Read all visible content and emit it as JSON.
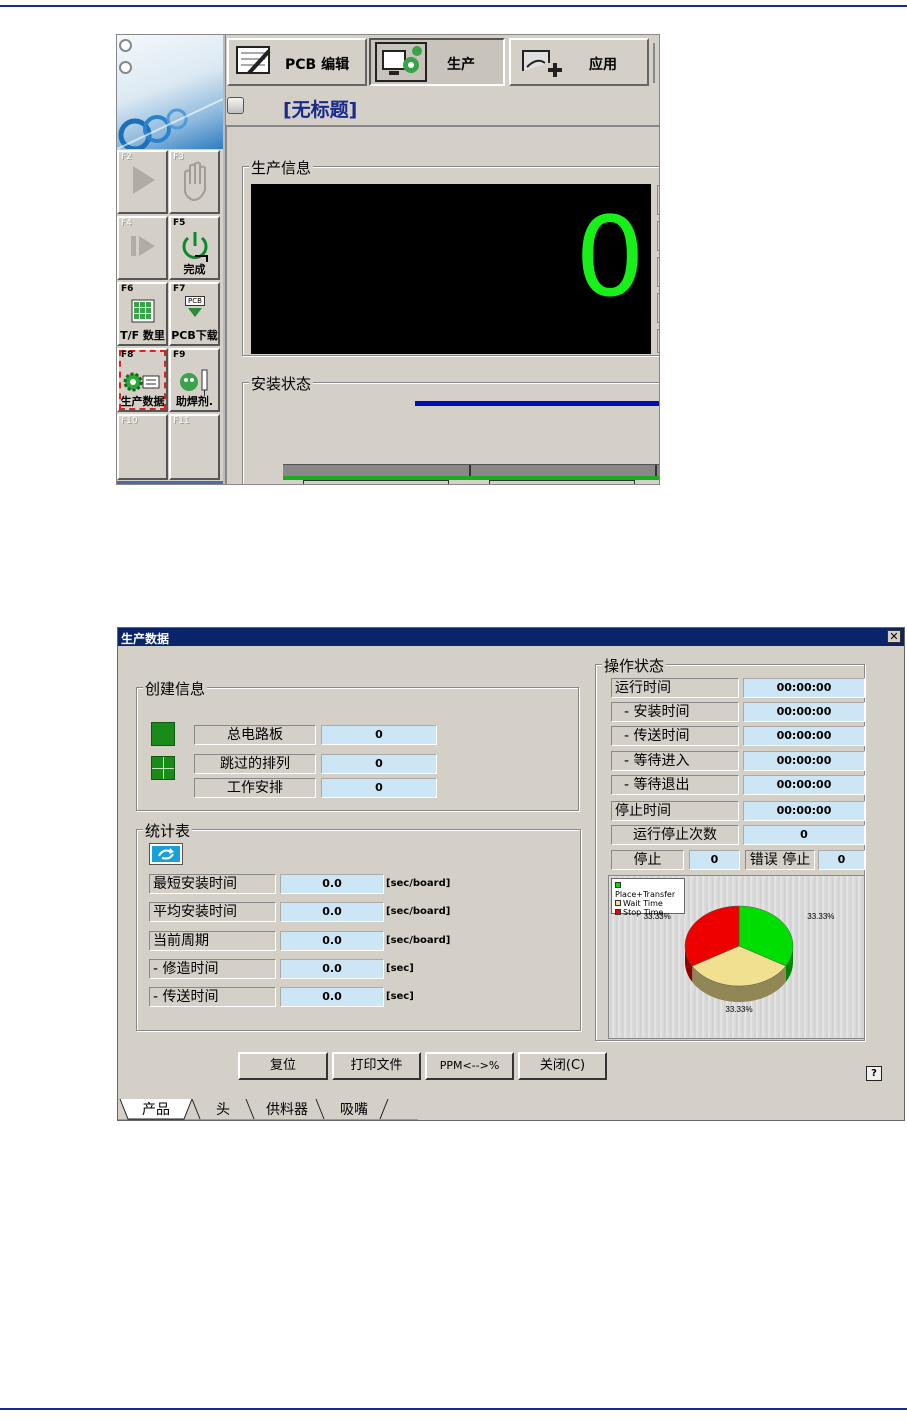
{
  "top_app": {
    "tabs": [
      {
        "label": "PCB 编辑"
      },
      {
        "label": "生产"
      },
      {
        "label": "应用"
      }
    ],
    "doc_title": "[无标题]",
    "fkeys": [
      {
        "key": "F2",
        "label": ""
      },
      {
        "key": "F3",
        "label": ""
      },
      {
        "key": "F4",
        "label": ""
      },
      {
        "key": "F5",
        "label": "完成"
      },
      {
        "key": "F6",
        "label": "T/F 数里"
      },
      {
        "key": "F7",
        "label": "PCB下载"
      },
      {
        "key": "F8",
        "label": "生产数据"
      },
      {
        "key": "F9",
        "label": "助焊剂."
      },
      {
        "key": "F10",
        "label": ""
      },
      {
        "key": "F11",
        "label": ""
      }
    ],
    "pcb_icon_text": "PCB",
    "production_info": {
      "title": "生产信息",
      "counter": "0"
    },
    "mount_status": {
      "title": "安装状态"
    }
  },
  "dialog": {
    "title": "生产数据",
    "close_glyph": "✕",
    "create_info": {
      "title": "创建信息",
      "rows": [
        {
          "label": "总电路板",
          "value": "0"
        },
        {
          "label": "跳过的排列",
          "value": "0"
        },
        {
          "label": "工作安排",
          "value": "0"
        }
      ]
    },
    "stats": {
      "title": "统计表",
      "rows": [
        {
          "label": "最短安装时间",
          "value": "0.0",
          "unit": "[sec/board]"
        },
        {
          "label": "平均安装时间",
          "value": "0.0",
          "unit": "[sec/board]"
        },
        {
          "label": "当前周期",
          "value": "0.0",
          "unit": "[sec/board]"
        },
        {
          "label": "- 修造时间",
          "value": "0.0",
          "unit": "[sec]"
        },
        {
          "label": "- 传送时间",
          "value": "0.0",
          "unit": "[sec]"
        }
      ]
    },
    "op_status": {
      "title": "操作状态",
      "rows": [
        {
          "label": "运行时间",
          "value": "00:00:00"
        },
        {
          "label": "- 安装时间",
          "value": "00:00:00"
        },
        {
          "label": "- 传送时间",
          "value": "00:00:00"
        },
        {
          "label": "- 等待进入",
          "value": "00:00:00"
        },
        {
          "label": "- 等待退出",
          "value": "00:00:00"
        },
        {
          "label": "停止时间",
          "value": "00:00:00"
        },
        {
          "label": "运行停止次数",
          "value": "0"
        }
      ],
      "stop_label": "停止",
      "stop_value": "0",
      "error_stop_label": "错误 停止",
      "error_stop_value": "0"
    },
    "chart_data": {
      "type": "pie",
      "legend": [
        "Place+Transfer",
        "Wait Time",
        "Stop Time"
      ],
      "values": [
        33.33,
        33.33,
        33.33
      ],
      "labels": [
        "33.33%",
        "33.33%",
        "33.33%"
      ],
      "colors": [
        "#00dd00",
        "#f0e090",
        "#ee0000"
      ],
      "legend_position": "top-left"
    },
    "buttons": [
      "复位",
      "打印文件",
      "PPM<-->%",
      "关闭(C)"
    ],
    "help_glyph": "?",
    "bottom_tabs": [
      "产品",
      "头",
      "供料器",
      "吸嘴"
    ]
  }
}
